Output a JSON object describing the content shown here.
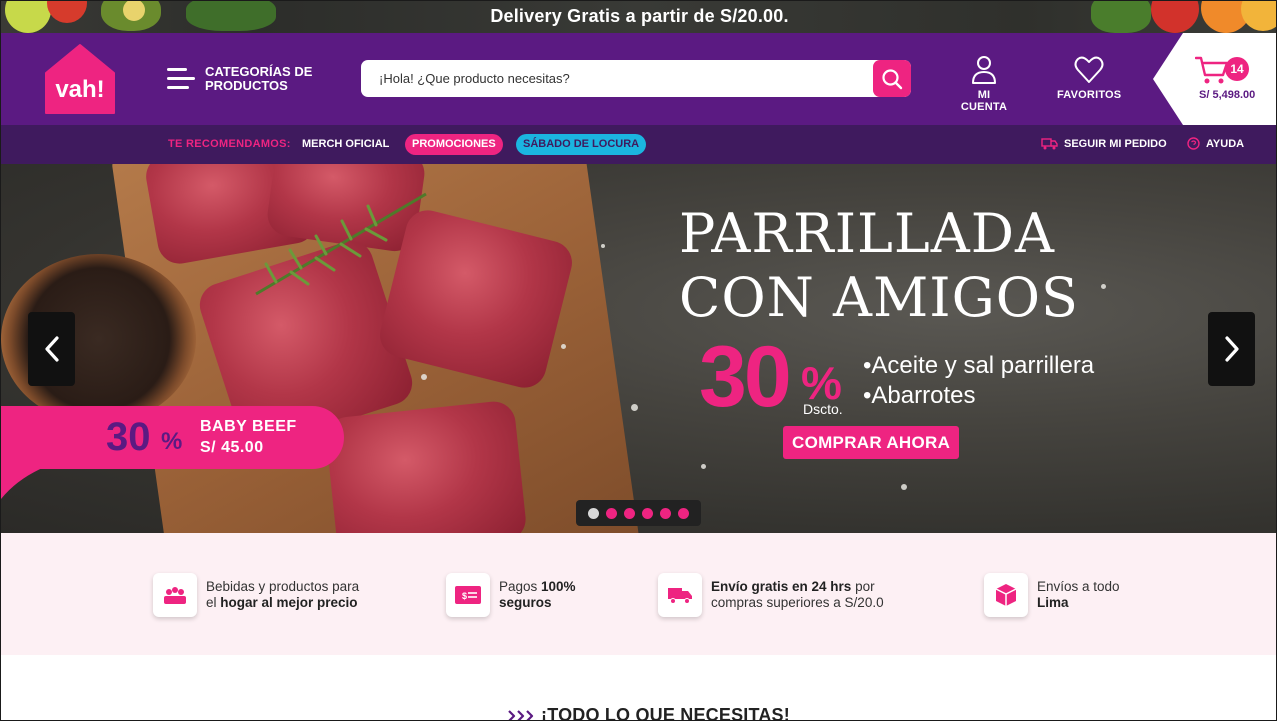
{
  "topbar": {
    "text": "Delivery Gratis a partir de S/20.00."
  },
  "header": {
    "logo_text": "vah!",
    "categories_line1": "CATEGORÍAS DE",
    "categories_line2": "PRODUCTOS",
    "search_placeholder": "¡Hola! ¿Que producto necesitas?",
    "account_label": "MI CUENTA",
    "favorites_label": "FAVORITOS",
    "cart_count": "14",
    "cart_total": "S/ 5,498.00"
  },
  "subnav": {
    "recommend_label": "TE RECOMENDAMOS:",
    "links": [
      "MERCH OFICIAL",
      "PROMOCIONES",
      "SÁBADO DE LOCURA"
    ],
    "track_order": "SEGUIR MI PEDIDO",
    "help": "AYUDA"
  },
  "hero": {
    "title_line1": "PARRILLADA",
    "title_line2": "CON AMIGOS",
    "discount_number": "30",
    "discount_symbol": "%",
    "discount_word": "Dscto.",
    "bullet1": "•Aceite y sal parrillera",
    "bullet2": "•Abarrotes",
    "cta": "COMPRAR AHORA",
    "promo_number": "30",
    "promo_symbol": "%",
    "promo_name": "BABY BEEF",
    "promo_price": "S/ 45.00",
    "slides_total": 6,
    "active_slide": 1
  },
  "benefits": [
    {
      "icon": "food-tray-icon",
      "line1": "Bebidas y productos para",
      "line2_plain": "el ",
      "line2_bold": "hogar al mejor precio"
    },
    {
      "icon": "payment-card-icon",
      "line1_plain": "Pagos ",
      "line1_bold": "100%",
      "line2_bold": "seguros"
    },
    {
      "icon": "delivery-truck-icon",
      "line1_bold": "Envío gratis en 24 hrs",
      "line1_plain": " por",
      "line2": "compras superiores a S/20.0"
    },
    {
      "icon": "package-box-icon",
      "line1": "Envíos a todo",
      "line2_bold": "Lima"
    }
  ],
  "section": {
    "title": "¡TODO LO QUE NECESITAS!"
  },
  "colors": {
    "purple": "#5b1a82",
    "dark_purple": "#3f1a5e",
    "pink": "#ee2481",
    "cyan": "#1bb5e0"
  }
}
